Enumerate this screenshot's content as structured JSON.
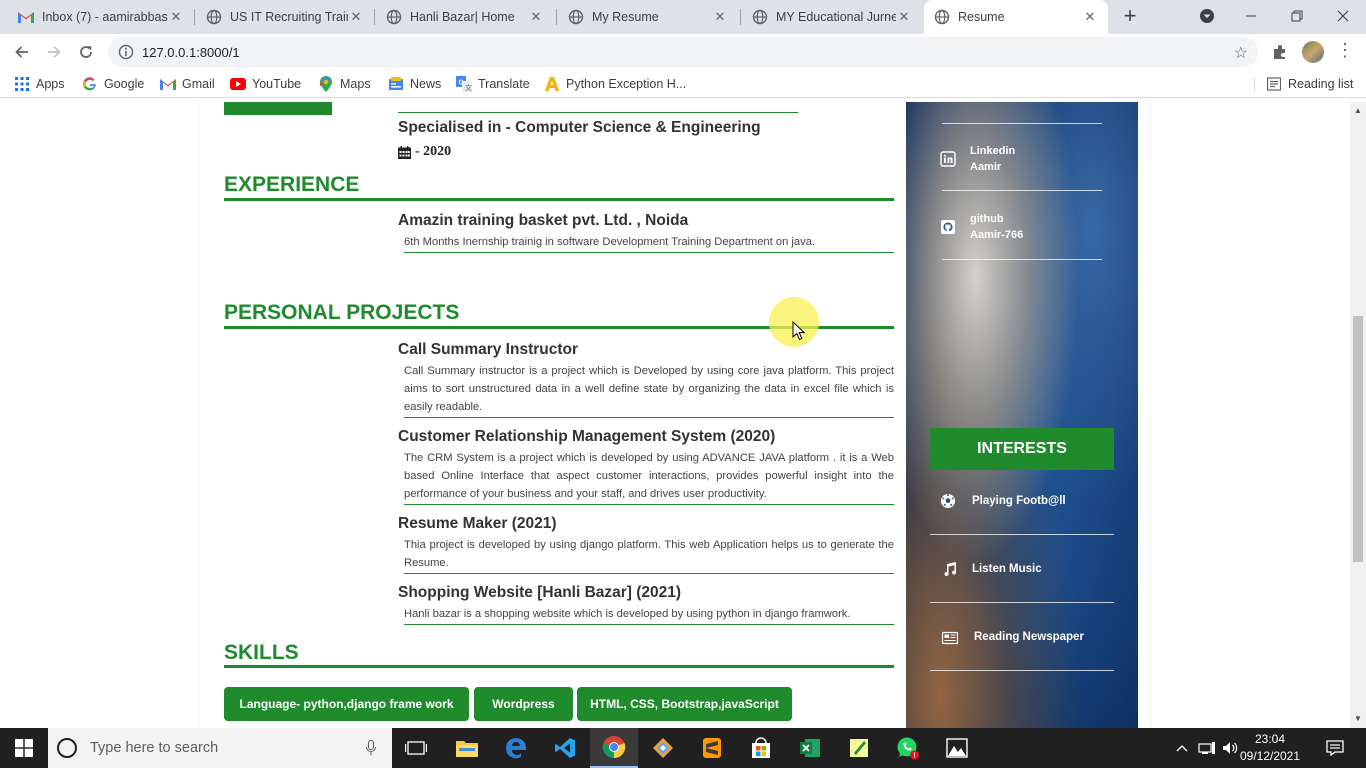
{
  "browser": {
    "tabs": [
      {
        "title": "Inbox (7) - aamirabbas",
        "favicon": "gmail-icon"
      },
      {
        "title": "US IT Recruiting Trainin",
        "favicon": "globe-icon"
      },
      {
        "title": "Hanli Bazar| Home",
        "favicon": "globe-icon"
      },
      {
        "title": "My Resume",
        "favicon": "globe-icon"
      },
      {
        "title": "MY Educational Jurney",
        "favicon": "globe-icon"
      },
      {
        "title": "Resume",
        "favicon": "globe-icon",
        "active": true
      }
    ],
    "url": "127.0.0.1:8000/1",
    "bookmarks": [
      {
        "label": "Apps",
        "icon": "apps-grid-icon"
      },
      {
        "label": "Google",
        "icon": "google-icon"
      },
      {
        "label": "Gmail",
        "icon": "gmail-icon"
      },
      {
        "label": "YouTube",
        "icon": "youtube-icon"
      },
      {
        "label": "Maps",
        "icon": "maps-icon"
      },
      {
        "label": "News",
        "icon": "news-icon"
      },
      {
        "label": "Translate",
        "icon": "translate-icon"
      },
      {
        "label": "Python Exception H...",
        "icon": "bookmark-a-icon"
      }
    ],
    "reading_list": "Reading list"
  },
  "resume": {
    "education": {
      "specialisation": "Specialised in - Computer Science & Engineering",
      "year": "- 2020"
    },
    "experience": {
      "heading": "EXPERIENCE",
      "items": [
        {
          "title": "Amazin training basket pvt. Ltd. , Noida",
          "description": "6th Months Inernship trainig in software Development Training Department on java."
        }
      ]
    },
    "projects": {
      "heading": "PERSONAL PROJECTS",
      "items": [
        {
          "title": "Call Summary Instructor",
          "description": "Call Summary instructor is a project which is Developed by using core java platform. This project aims to sort unstructured data in a well define state by organizing the data in excel file which is easily readable."
        },
        {
          "title": "Customer Relationship Management System (2020)",
          "description": "The CRM System is a project which is developed by using ADVANCE JAVA platform . it is a Web based Online Interface that aspect customer interactions, provides powerful insight into the performance of your business and your staff, and drives user productivity."
        },
        {
          "title": "Resume Maker (2021)",
          "description": "Thia project is developed by using django platform. This web Application helps us to generate the Resume."
        },
        {
          "title": "Shopping Website [Hanli Bazar] (2021)",
          "description": "Hanli bazar is a shopping website which is developed by using python in django framwork."
        }
      ]
    },
    "skills": {
      "heading": "SKILLS",
      "items": [
        "Language- python,django frame work",
        "Wordpress",
        "HTML, CSS, Bootstrap,javaScript"
      ]
    },
    "sidebar": {
      "contacts": [
        {
          "label": "Linkedin",
          "value": "Aamir",
          "icon": "linkedin-icon"
        },
        {
          "label": "github",
          "value": "Aamir-766",
          "icon": "github-icon"
        }
      ],
      "interests_heading": "INTERESTS",
      "interests": [
        {
          "label": "Playing Footb@ll",
          "icon": "football-icon"
        },
        {
          "label": "Listen Music",
          "icon": "music-icon"
        },
        {
          "label": "Reading Newspaper",
          "icon": "newspaper-icon"
        }
      ]
    }
  },
  "taskbar": {
    "search_placeholder": "Type here to search",
    "time": "23:04",
    "date": "09/12/2021"
  },
  "colors": {
    "accent_green": "#1f8b2c",
    "tabstrip": "#dee1e6",
    "taskbar": "#202020"
  }
}
